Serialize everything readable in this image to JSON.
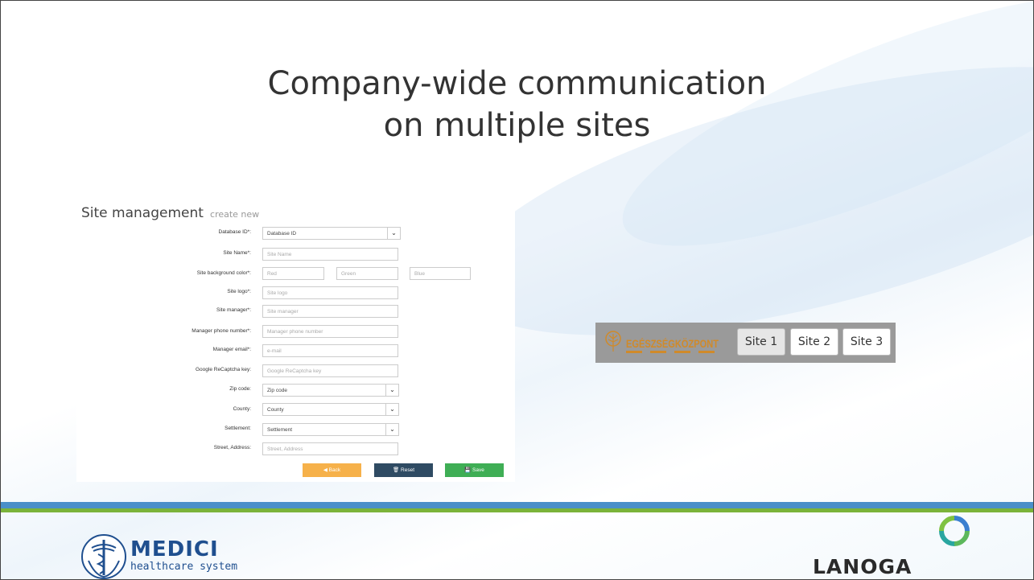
{
  "slide": {
    "title_line1": "Company-wide communication",
    "title_line2": "on multiple sites"
  },
  "site_form": {
    "title": "Site management",
    "subtitle": "create new",
    "fields": {
      "database_id": {
        "label": "Database ID*:",
        "value": "Database ID"
      },
      "site_name": {
        "label": "Site Name*:",
        "placeholder": "Site Name"
      },
      "background_color": {
        "label": "Site background color*:",
        "red": "Red",
        "green": "Green",
        "blue": "Blue"
      },
      "site_logo": {
        "label": "Site logo*:",
        "placeholder": "Site logo"
      },
      "site_manager": {
        "label": "Site manager*:",
        "placeholder": "Site manager"
      },
      "manager_phone": {
        "label": "Manager phone number*:",
        "placeholder": "Manager phone number"
      },
      "manager_email": {
        "label": "Manager email*:",
        "placeholder": "e-mail"
      },
      "recaptcha": {
        "label": "Google ReCaptcha key:",
        "placeholder": "Google ReCaptcha key"
      },
      "zip_code": {
        "label": "Zip code:",
        "value": "Zip code"
      },
      "county": {
        "label": "County:",
        "value": "County"
      },
      "settlement": {
        "label": "Settlement:",
        "value": "Settlement"
      },
      "street_address": {
        "label": "Street, Address:",
        "placeholder": "Street, Address"
      }
    },
    "buttons": {
      "back": "◀ Back",
      "reset": "🗑 Reset",
      "save": "💾 Save"
    }
  },
  "site_switcher": {
    "brand": "EGÉSZSÉGKÖZPONT",
    "sites": [
      "Site 1",
      "Site 2",
      "Site 3"
    ],
    "active_index": 0
  },
  "footer": {
    "medici_logo": {
      "word": "MEDICI",
      "tagline": "healthcare system"
    },
    "lanoga_logo": {
      "word": "LANOGA"
    }
  },
  "colors": {
    "back_button": "#f6b14a",
    "reset_button": "#2f4b63",
    "save_button": "#3fae55",
    "rule_blue": "#4a8fc9",
    "rule_green": "#7bb33a"
  }
}
